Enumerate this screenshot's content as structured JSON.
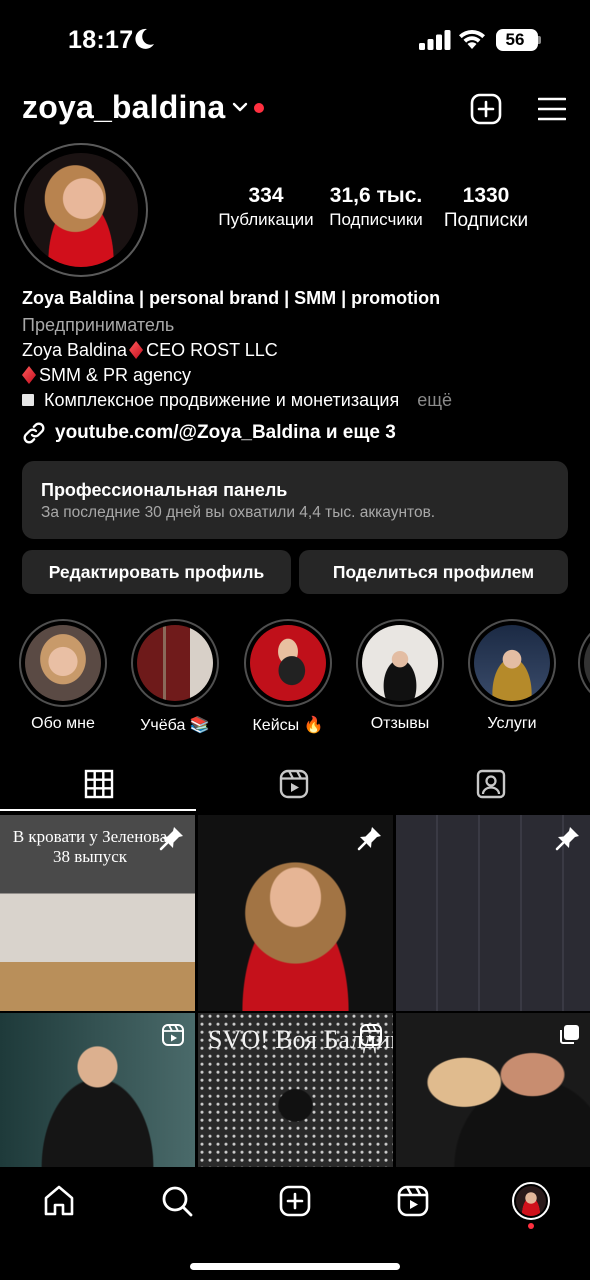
{
  "status": {
    "time": "18:17",
    "battery": "56"
  },
  "header": {
    "username": "zoya_baldina"
  },
  "stats": [
    {
      "value": "334",
      "label": "Публикации"
    },
    {
      "value": "31,6 тыс.",
      "label": "Подписчики"
    },
    {
      "value": "1330",
      "label": "Подписки"
    }
  ],
  "bio": {
    "name": "Zoya Baldina | personal brand | SMM | promotion",
    "category": "Предприниматель",
    "line1_a": "Zoya Baldina",
    "line1_b": "CEO ROST LLC",
    "line2": "SMM & PR agency",
    "line3": "Комплексное продвижение и монетизация",
    "more": "ещё",
    "link": "youtube.com/@Zoya_Baldina и еще 3"
  },
  "pro_panel": {
    "title": "Профессиональная панель",
    "subtitle": "За последние 30 дней вы охватили 4,4 тыс. аккаунтов."
  },
  "buttons": {
    "edit": "Редактировать профиль",
    "share": "Поделиться профилем"
  },
  "highlights": [
    {
      "label": "Обо мне"
    },
    {
      "label": "Учёба 📚"
    },
    {
      "label": "Кейсы 🔥"
    },
    {
      "label": "Отзывы"
    },
    {
      "label": "Услуги"
    }
  ],
  "posts": {
    "p1_caption": "В кровати у Зеленова 38 выпуск",
    "p5_caption": "SVO! Воя Балдина"
  },
  "icons": {
    "moon": "moon-icon",
    "signal": "cellular-signal-icon",
    "wifi": "wifi-icon",
    "plus": "new-post-icon",
    "menu": "hamburger-menu-icon",
    "link": "link-icon",
    "grid": "grid-icon",
    "reels": "reels-icon",
    "tagged": "tagged-icon",
    "pin": "pin-icon",
    "home": "home-icon",
    "search": "search-icon"
  },
  "colors": {
    "accent_red": "#ff3040",
    "panel": "#262626",
    "muted": "#a8a8a8"
  }
}
